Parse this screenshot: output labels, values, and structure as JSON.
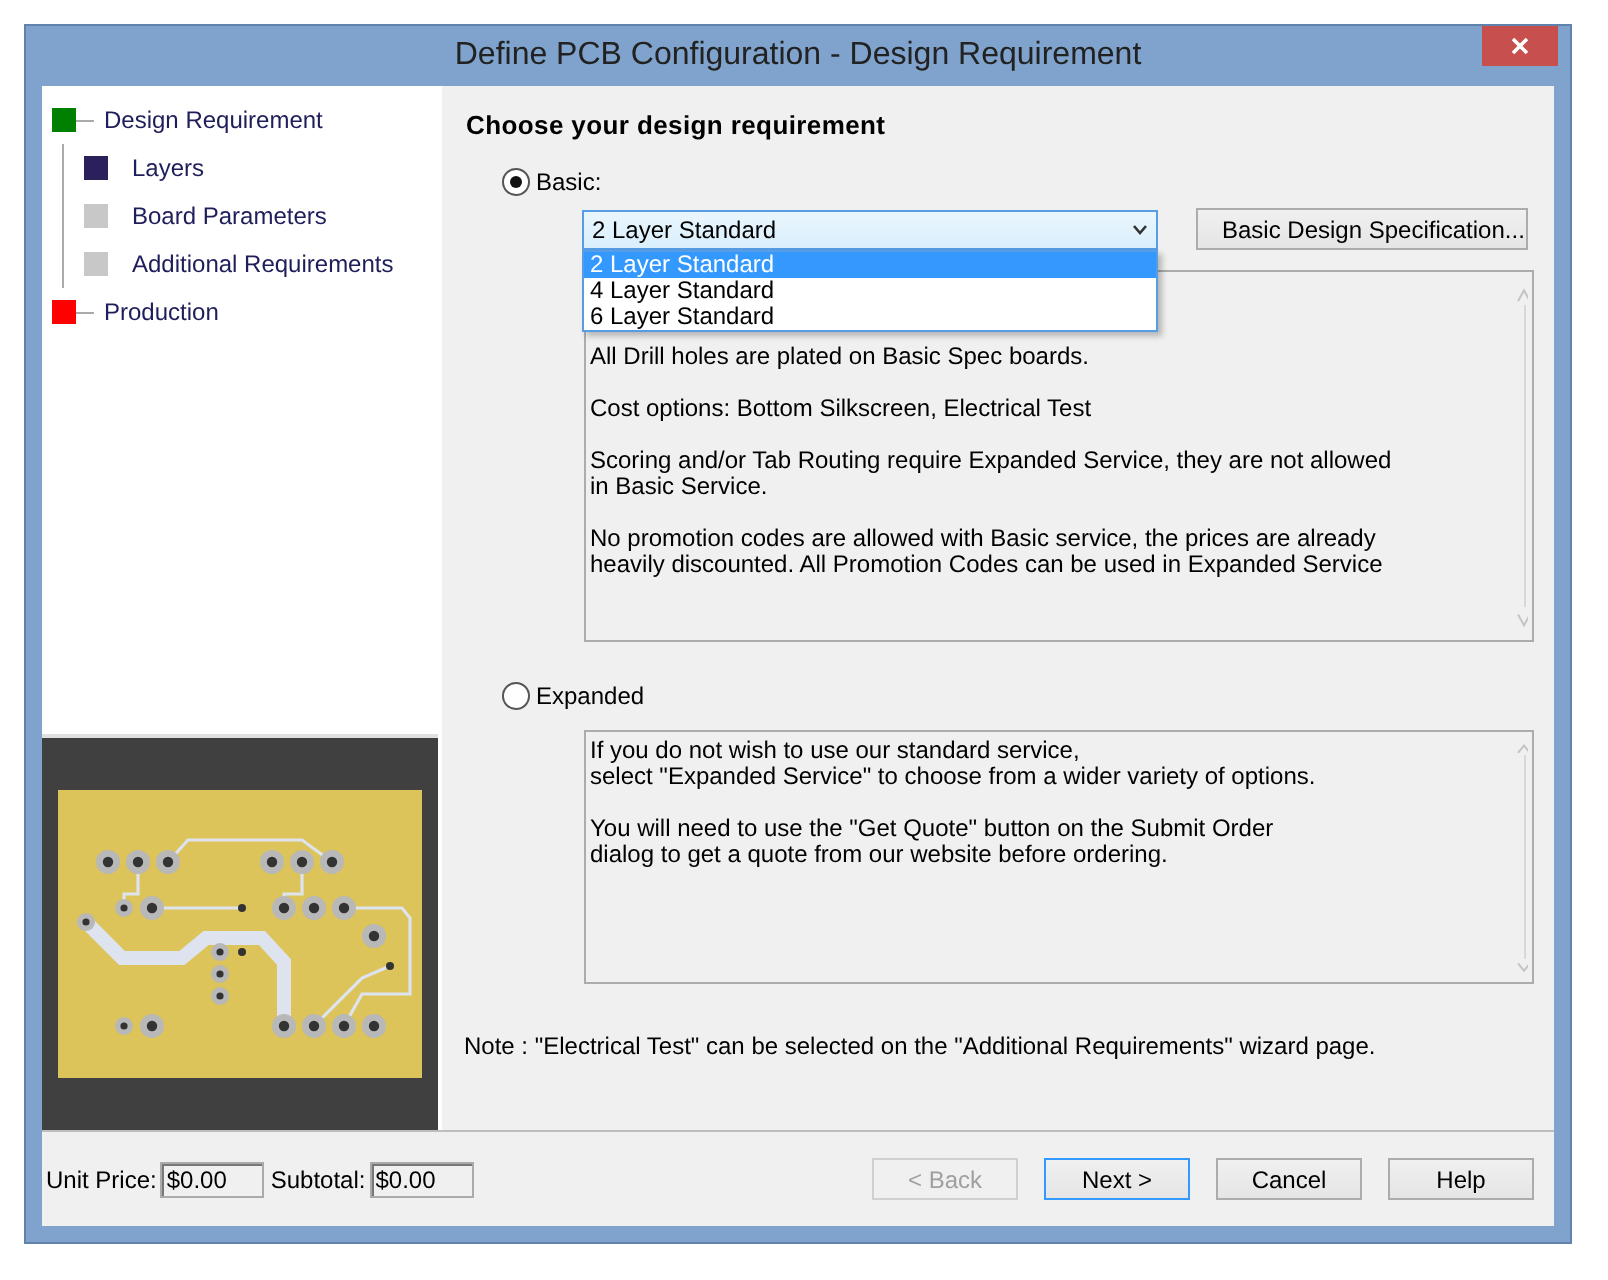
{
  "window": {
    "title": "Define PCB Configuration - Design Requirement"
  },
  "steps": [
    {
      "label": "Design Requirement",
      "color": "#008000",
      "children": [
        {
          "label": "Layers",
          "color": "#2b1f5c"
        },
        {
          "label": "Board Parameters",
          "color": "#c8c8c8"
        },
        {
          "label": "Additional Requirements",
          "color": "#c8c8c8"
        }
      ]
    },
    {
      "label": "Production",
      "color": "#ff0000"
    }
  ],
  "pricing": {
    "unit_price_label": "Unit Price:",
    "unit_price": "$0.00",
    "subtotal_label": "Subtotal:",
    "subtotal": "$0.00"
  },
  "heading": "Choose your design requirement",
  "options": [
    {
      "kind": "basic",
      "label": "Basic:",
      "selected": true,
      "combo": {
        "value": "2 Layer Standard",
        "expanded": true,
        "items": [
          {
            "label": "2 Layer Standard",
            "selected": true
          },
          {
            "label": "4 Layer Standard",
            "selected": false
          },
          {
            "label": "6 Layer Standard",
            "selected": false
          }
        ]
      },
      "spec_button": "Basic Design Specification...",
      "description": [
        "All Drill holes are plated on Basic Spec boards.",
        "Cost options:  Bottom Silkscreen,  Electrical Test",
        "Scoring and/or Tab Routing require Expanded Service, they are not allowed\nin Basic Service.",
        "No promotion codes are allowed with Basic service, the prices are already\nheavily discounted.  All Promotion Codes can be used in Expanded Service"
      ]
    },
    {
      "kind": "expanded",
      "label": "Expanded",
      "selected": false,
      "description": [
        "If you do not wish to use our standard service,\nselect  \"Expanded Service\" to choose from a wider variety of options.",
        "You will need to use the \"Get Quote\" button on the Submit Order\ndialog to get a quote from our website before ordering."
      ]
    }
  ],
  "note": "Note : \"Electrical Test\" can be selected on the \"Additional Requirements\" wizard page.",
  "buttons": [
    {
      "label": "< Back",
      "disabled": true,
      "focused": false
    },
    {
      "label": "Next >",
      "disabled": false,
      "focused": true
    },
    {
      "label": "Cancel",
      "disabled": false,
      "focused": false
    },
    {
      "label": "Help",
      "disabled": false,
      "focused": false
    }
  ]
}
